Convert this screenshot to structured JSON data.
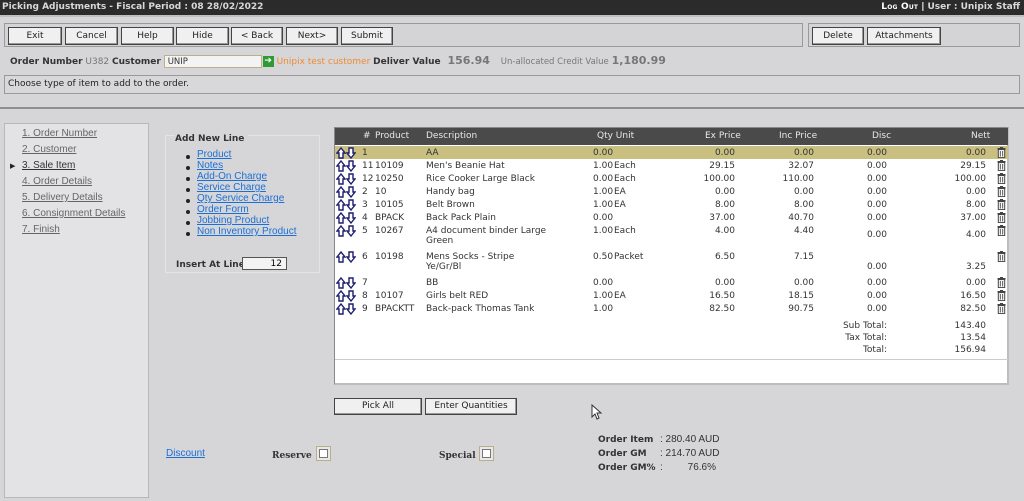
{
  "titlebar": {
    "title": "Picking Adjustments - Fiscal Period : 08 28/02/2022",
    "logout": "Log Out",
    "separator": "|",
    "user": "User : Unipix Staff"
  },
  "toolbar": {
    "exit": "Exit",
    "cancel": "Cancel",
    "help": "Help",
    "hide": "Hide",
    "back": "< Back",
    "next": "Next>",
    "submit": "Submit",
    "delete": "Delete",
    "attachments": "Attachments"
  },
  "order": {
    "number_label": "Order Number",
    "number": "U382",
    "customer_label": "Customer",
    "customer_code": "UNIP",
    "go_icon": "green-arrow-icon",
    "customer_name": "Unipix test customer",
    "deliver_label": "Deliver Value",
    "deliver_value": "156.94",
    "credit_label": "Un-allocated Credit Value",
    "credit_value": "1,180.99"
  },
  "message": "Choose type of item to add to the order.",
  "steps": [
    {
      "label": "1. Order Number",
      "active": false
    },
    {
      "label": "2. Customer",
      "active": false
    },
    {
      "label": "3. Sale Item",
      "active": true
    },
    {
      "label": "4. Order Details",
      "active": false
    },
    {
      "label": "5. Delivery Details",
      "active": false
    },
    {
      "label": "6. Consignment Details",
      "active": false
    },
    {
      "label": "7. Finish",
      "active": false
    }
  ],
  "add_new_line": {
    "title": "Add New Line",
    "links": [
      "Product",
      "Notes",
      "Add-On Charge",
      "Service Charge",
      "Qty Service Charge",
      "Order Form",
      "Jobbing Product",
      "Non Inventory Product"
    ],
    "insert_label": "Insert At Line",
    "insert_value": "12"
  },
  "grid": {
    "columns": {
      "num": "#",
      "product": "Product",
      "description": "Description",
      "qty_unit": "Qty Unit",
      "ex_price": "Ex Price",
      "inc_price": "Inc Price",
      "disc": "Disc",
      "nett": "Nett"
    },
    "rows": [
      {
        "num": "1",
        "product": "",
        "description": "AA",
        "qty": "0.00",
        "unit": "",
        "ex": "0.00",
        "inc": "0.00",
        "disc": "0.00",
        "nett": "0.00",
        "selected": true
      },
      {
        "num": "11",
        "product": "10109",
        "description": "Men's Beanie Hat",
        "qty": "1.00",
        "unit": "Each",
        "ex": "29.15",
        "inc": "32.07",
        "disc": "0.00",
        "nett": "29.15"
      },
      {
        "num": "12",
        "product": "10250",
        "description": "Rice Cooker Large Black",
        "qty": "0.00",
        "unit": "Each",
        "ex": "100.00",
        "inc": "110.00",
        "disc": "0.00",
        "nett": "100.00"
      },
      {
        "num": "2",
        "product": "10",
        "description": "Handy bag",
        "qty": "1.00",
        "unit": "EA",
        "ex": "0.00",
        "inc": "0.00",
        "disc": "0.00",
        "nett": "0.00"
      },
      {
        "num": "3",
        "product": "10105",
        "description": "Belt Brown",
        "qty": "1.00",
        "unit": "EA",
        "ex": "8.00",
        "inc": "8.00",
        "disc": "0.00",
        "nett": "8.00"
      },
      {
        "num": "4",
        "product": "BPACK",
        "description": "Back Pack Plain",
        "qty": "0.00",
        "unit": "",
        "ex": "37.00",
        "inc": "40.70",
        "disc": "0.00",
        "nett": "37.00"
      },
      {
        "num": "5",
        "product": "10267",
        "description": "A4 document binder Large",
        "description2": "Green",
        "qty": "1.00",
        "unit": "Each",
        "ex": "4.00",
        "inc": "4.40",
        "disc": "0.00",
        "nett": "4.00"
      },
      {
        "num": "6",
        "product": "10198",
        "description": "Mens Socks - Stripe",
        "description2": "Ye/Gr/Bl",
        "qty": "0.50",
        "unit": "Packet",
        "ex": "6.50",
        "inc": "7.15",
        "disc": "0.00",
        "nett": "3.25"
      },
      {
        "num": "7",
        "product": "",
        "description": "BB",
        "qty": "0.00",
        "unit": "",
        "ex": "0.00",
        "inc": "0.00",
        "disc": "0.00",
        "nett": "0.00"
      },
      {
        "num": "8",
        "product": "10107",
        "description": "Girls belt RED",
        "qty": "1.00",
        "unit": "EA",
        "ex": "16.50",
        "inc": "18.15",
        "disc": "0.00",
        "nett": "16.50"
      },
      {
        "num": "9",
        "product": "BPACKTT",
        "description": "Back-pack Thomas Tank",
        "qty": "1.00",
        "unit": "",
        "ex": "82.50",
        "inc": "90.75",
        "disc": "0.00",
        "nett": "82.50"
      }
    ],
    "totals": {
      "sub_label": "Sub Total:",
      "sub": "143.40",
      "tax_label": "Tax Total:",
      "tax": "13.54",
      "total_label": "Total:",
      "total": "156.94"
    }
  },
  "actions": {
    "pick_all": "Pick All",
    "enter_quantities": "Enter Quantities"
  },
  "footer": {
    "discount": "Discount",
    "reserve_label": "Reserve",
    "reserve_checked": false,
    "special_label": "Special",
    "special_checked": false,
    "order_item_label": "Order Item",
    "order_item_value": ": 280.40 AUD",
    "order_gm_label": "Order GM",
    "order_gm_value": ": 214.70 AUD",
    "order_gmp_label": "Order GM%",
    "order_gmp_colon": ":",
    "order_gmp_value": "76.6%"
  }
}
